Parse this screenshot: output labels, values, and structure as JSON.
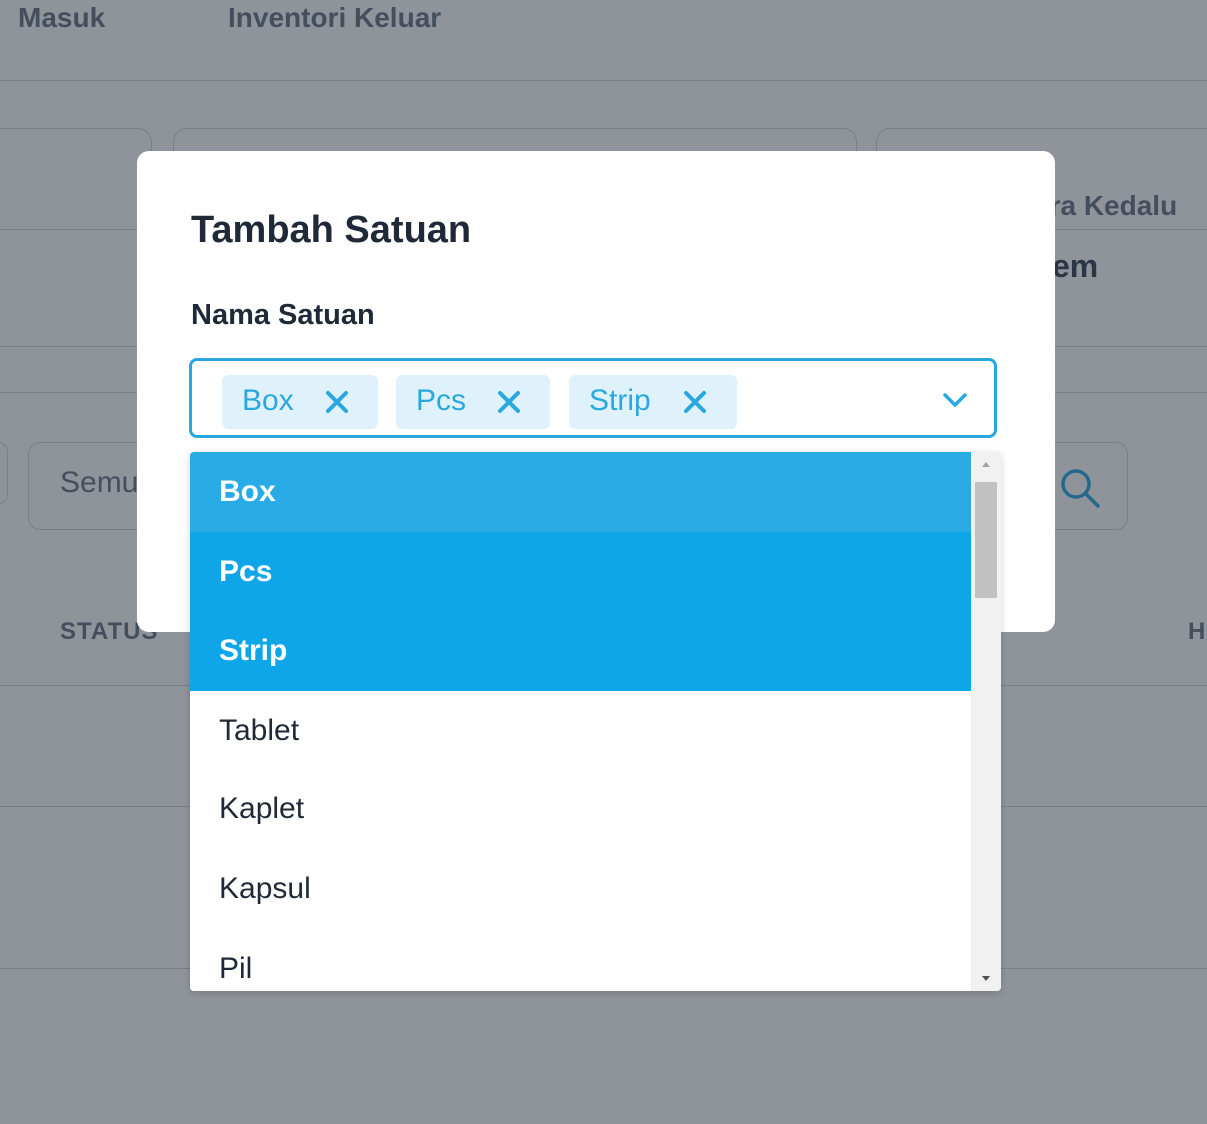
{
  "background": {
    "tabs": [
      "Masuk",
      "Inventori Keluar"
    ],
    "card_label": "era Kedalu",
    "card_value": "em",
    "filter_placeholder": "Semu",
    "table_headers": [
      "STATUS",
      "H"
    ]
  },
  "modal": {
    "title": "Tambah Satuan",
    "field_label": "Nama Satuan"
  },
  "select": {
    "selected_chips": [
      "Box",
      "Pcs",
      "Strip"
    ],
    "remove_icon": "close-icon",
    "toggle_icon": "chevron-down-icon"
  },
  "dropdown": {
    "options": [
      "Box",
      "Pcs",
      "Strip",
      "Tablet",
      "Kaplet",
      "Kapsul",
      "Pil"
    ],
    "highlighted_index": 0,
    "selected_indices": [
      0,
      1,
      2
    ]
  },
  "colors": {
    "accent": "#29a8e0",
    "chip_bg": "#dff1fb",
    "selected_option_bg": "#0ea5e9",
    "highlighted_option_bg": "#29ace6",
    "overlay": "rgba(31,41,55,0.5)"
  }
}
